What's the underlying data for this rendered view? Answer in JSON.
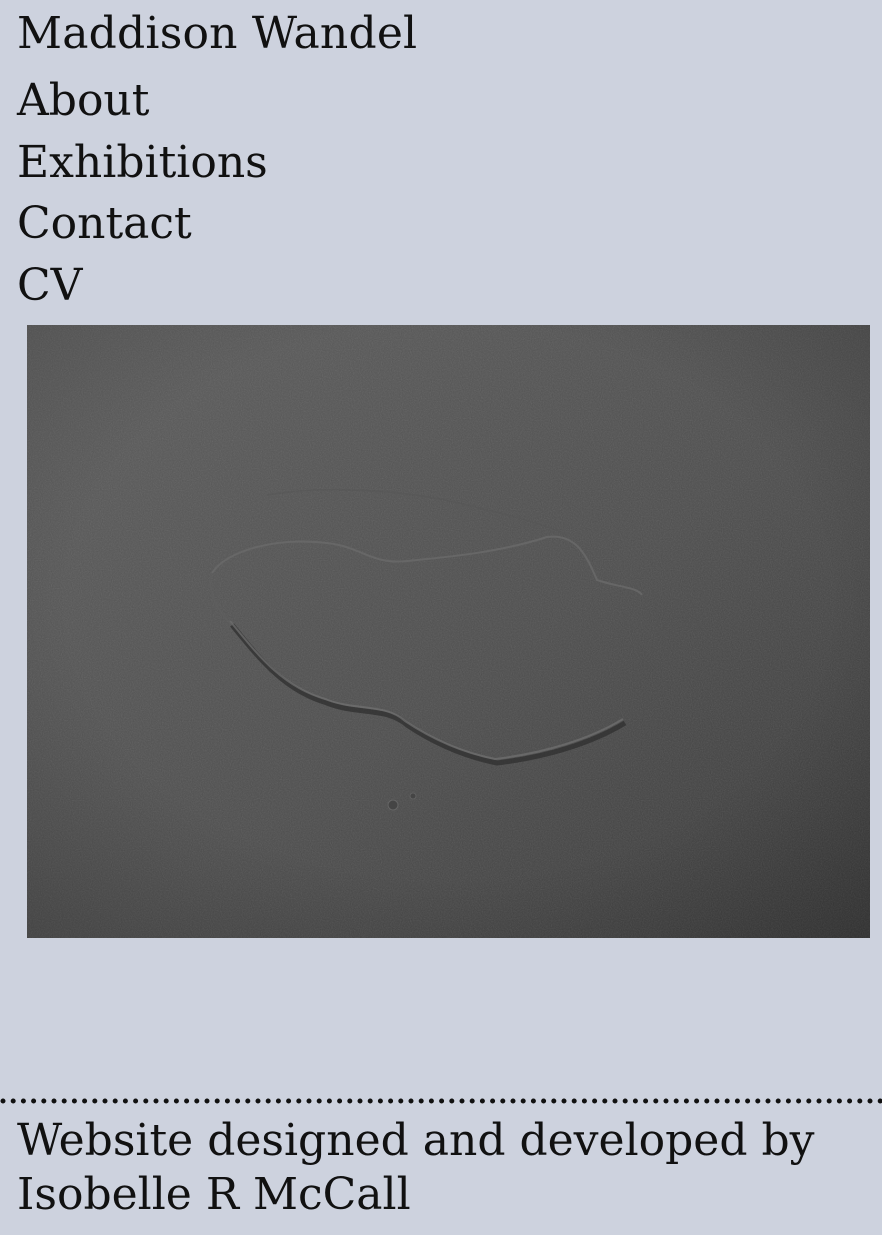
{
  "header": {
    "site_title": "Maddison Wandel"
  },
  "nav": {
    "items": [
      {
        "label": "About"
      },
      {
        "label": "Exhibitions"
      },
      {
        "label": "Contact"
      },
      {
        "label": "CV"
      }
    ]
  },
  "artwork": {
    "colors": {
      "background": "#cdd2de",
      "surface_light": "#5a5a5a",
      "surface_dark": "#3b3b3b"
    }
  },
  "footer": {
    "credit_line_1": "Website designed and developed by",
    "credit_line_2": "Isobelle R McCall"
  }
}
